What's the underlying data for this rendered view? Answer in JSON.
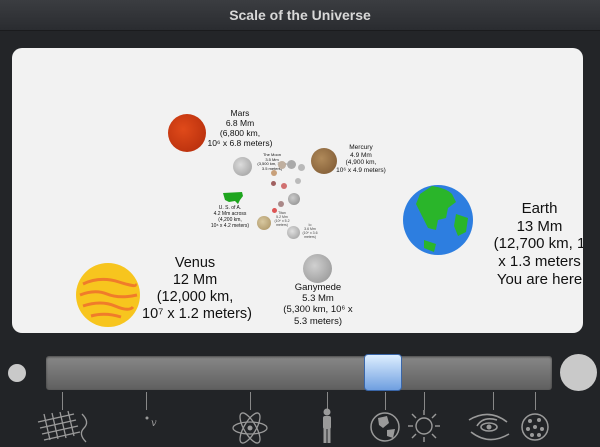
{
  "app": {
    "title": "Scale of the Universe"
  },
  "objects": {
    "mars": {
      "lines": [
        "Mars",
        "6.8 Mm",
        "(6,800 km,",
        "10⁶ x 6.8 meters)"
      ]
    },
    "mercury": {
      "lines": [
        "Mercury",
        "4.9 Mm",
        "(4,900 km,",
        "10⁶ x 4.9 meters)"
      ]
    },
    "moon": {
      "lines": [
        "The Moon",
        "3.5 Mm",
        "(3,500 km, 10⁶ x",
        "3.5 meters)"
      ]
    },
    "usa": {
      "lines": [
        "U. S. of A.",
        "4.2 Mm across",
        "(4,200 km,",
        "10⁶ x 4.2 meters)"
      ]
    },
    "titan": {
      "lines": [
        "Titan",
        "5.2 Mm",
        "(10⁶ x 5.2",
        "meters)"
      ]
    },
    "io": {
      "lines": [
        "Io",
        "3.6 Mm",
        "(10⁶ x 3.6",
        "meters)"
      ]
    },
    "venus": {
      "lines": [
        "Venus",
        "12 Mm",
        "(12,000 km,",
        "10⁷ x 1.2 meters)"
      ]
    },
    "ganymede": {
      "lines": [
        "Ganymede",
        "5.3 Mm",
        "(5,300 km, 10⁶ x",
        "5.3 meters)"
      ]
    },
    "earth": {
      "lines": [
        "Earth",
        "13 Mm",
        "(12,700 km, 1",
        "x 1.3 meters",
        "You are here"
      ]
    }
  },
  "slider": {
    "position_fraction": 0.64
  },
  "toolbar": {
    "icons": [
      "strings-grid-icon",
      "quark-icon",
      "atom-icon",
      "person-icon",
      "earth-icon",
      "sun-icon",
      "galaxy-icon",
      "universe-icon"
    ]
  },
  "colors": {
    "accent": "#6f9fe0",
    "panel": "#f2f2f2",
    "background": "#232528"
  }
}
